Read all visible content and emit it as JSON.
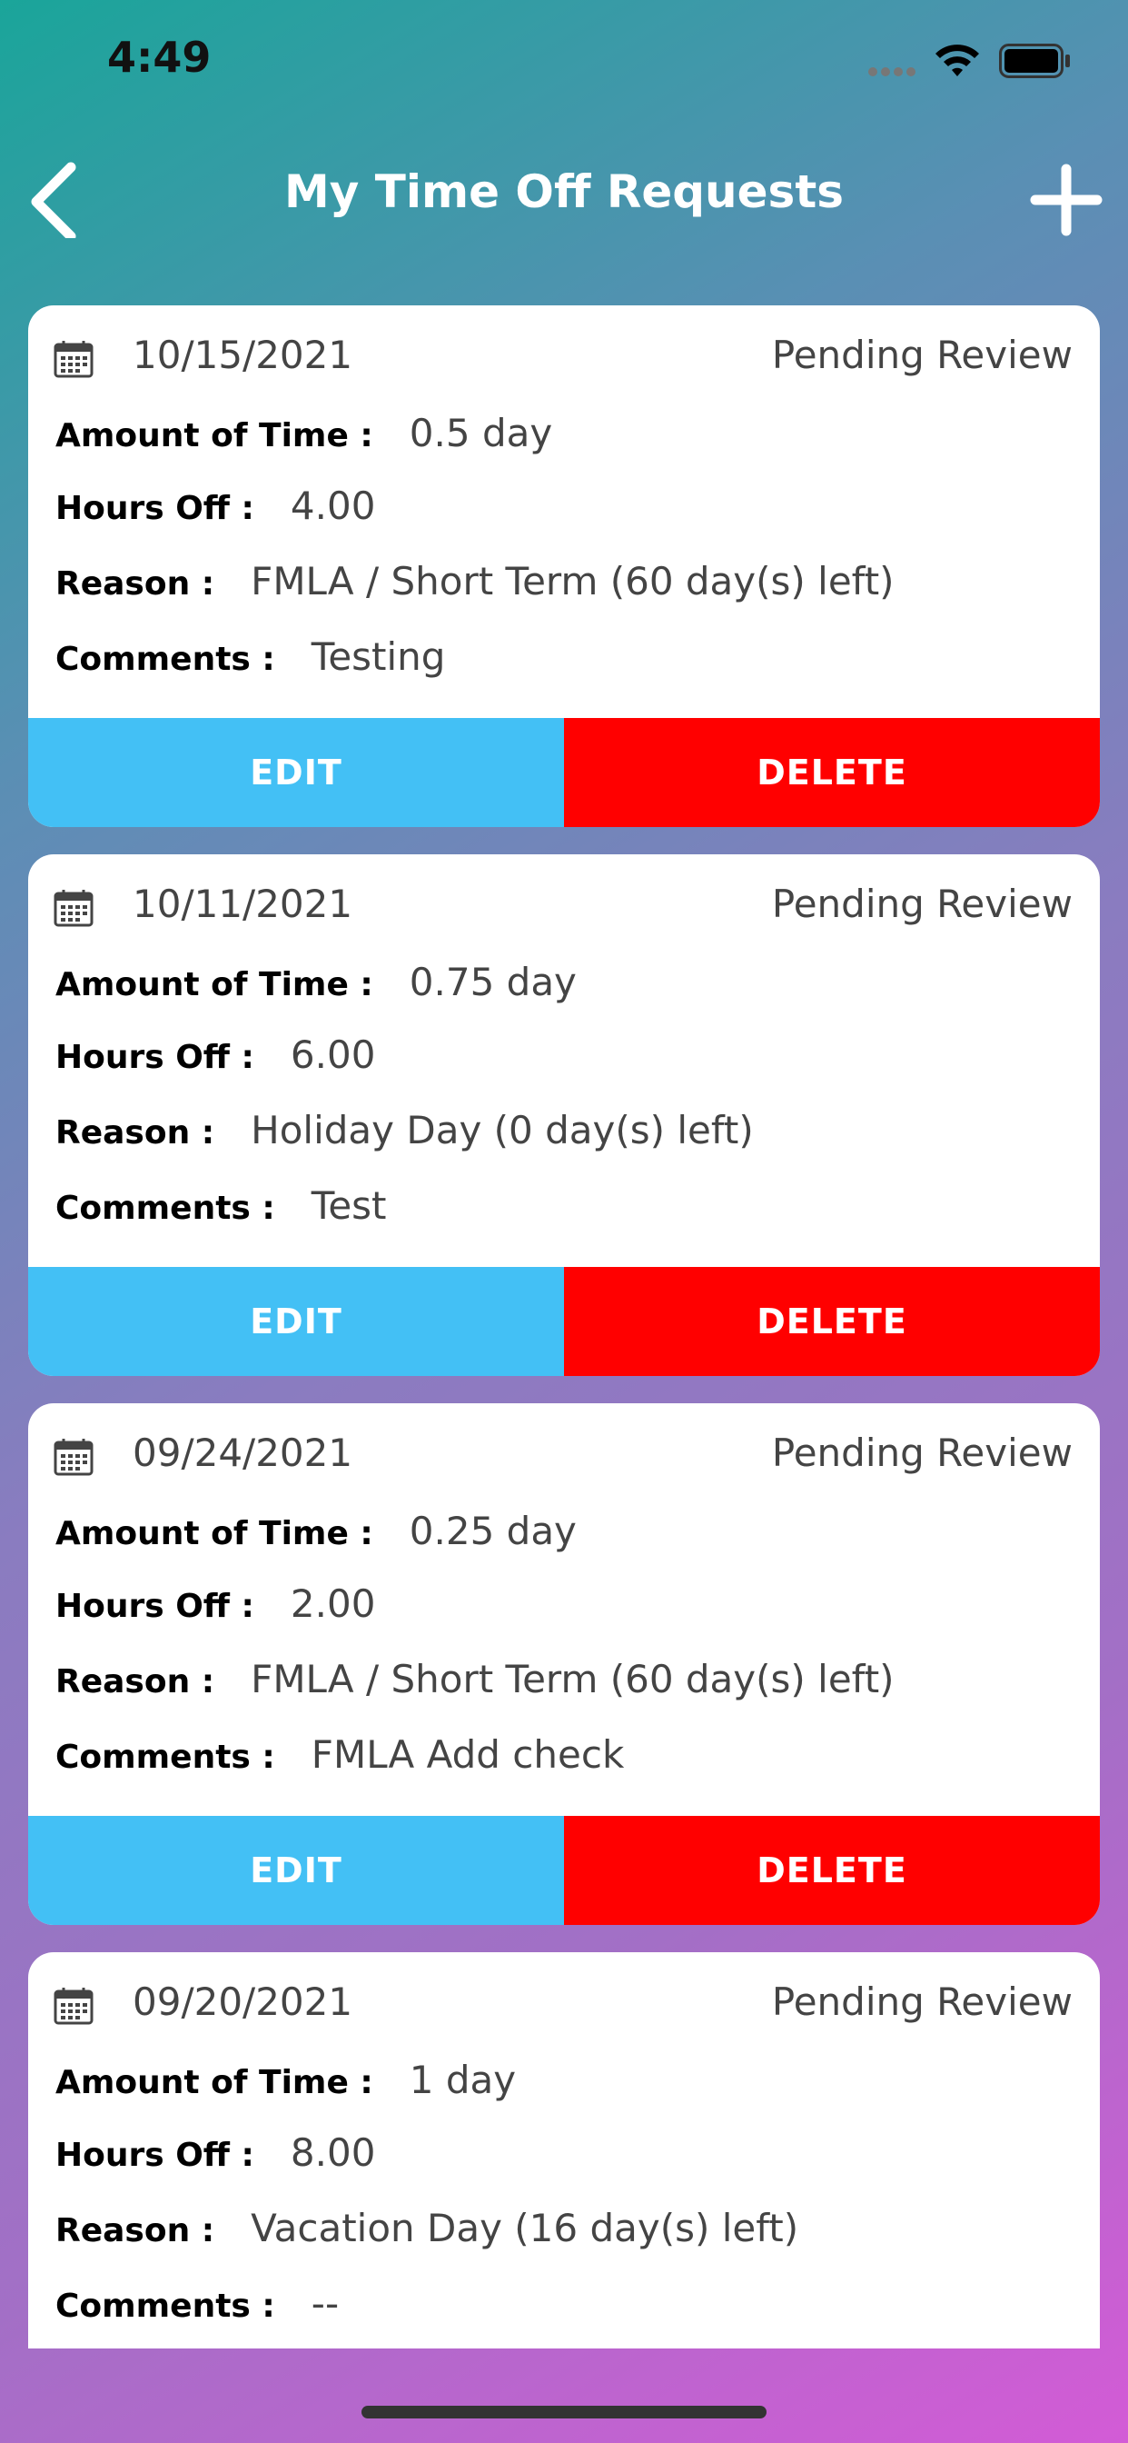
{
  "status_bar": {
    "time": "4:49"
  },
  "nav": {
    "title": "My Time Off Requests"
  },
  "labels": {
    "amount": "Amount of Time :",
    "hours": "Hours Off :",
    "reason": "Reason :",
    "comments": "Comments :",
    "edit": "EDIT",
    "delete": "DELETE"
  },
  "requests": [
    {
      "date": "10/15/2021",
      "status": "Pending Review",
      "amount": "0.5 day",
      "hours": "4.00",
      "reason": "FMLA / Short Term (60 day(s) left)",
      "comments": "Testing"
    },
    {
      "date": "10/11/2021",
      "status": "Pending Review",
      "amount": "0.75 day",
      "hours": "6.00",
      "reason": "Holiday Day (0 day(s) left)",
      "comments": "Test"
    },
    {
      "date": "09/24/2021",
      "status": "Pending Review",
      "amount": "0.25 day",
      "hours": "2.00",
      "reason": "FMLA / Short Term (60 day(s) left)",
      "comments": "FMLA Add check"
    },
    {
      "date": "09/20/2021",
      "status": "Pending Review",
      "amount": "1 day",
      "hours": "8.00",
      "reason": "Vacation Day (16 day(s) left)",
      "comments": "--"
    }
  ],
  "colors": {
    "edit": "#43c0f5",
    "delete": "#ff0000"
  }
}
